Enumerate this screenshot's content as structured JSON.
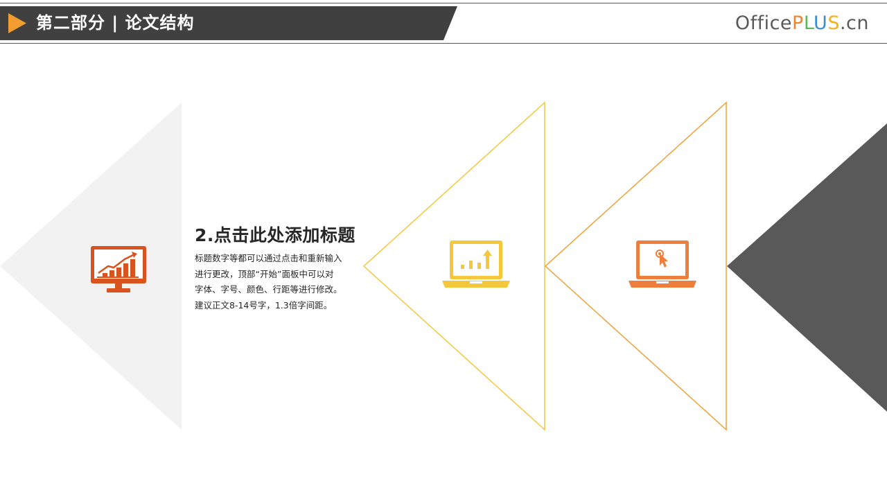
{
  "header": {
    "section_title": "第二部分 | 论文结构",
    "brand": {
      "part1": "Office",
      "p": "P",
      "l": "L",
      "u": "U",
      "s": "S",
      "suffix": ".cn"
    }
  },
  "content": {
    "heading": "2.点击此处添加标题",
    "body_lines": [
      "标题数字等都可以通过点击和重新输入",
      "进行更改，顶部“开始”面板中可以对",
      "字体、字号、颜色、行距等进行修改。",
      "建议正文8-14号字，1.3倍字间距。"
    ]
  },
  "icons": [
    "monitor-chart-icon",
    "laptop-chart-icon",
    "laptop-cursor-icon"
  ],
  "colors": {
    "header_bg": "#404040",
    "accent_orange": "#f39c2f",
    "icon_red": "#d9531e",
    "icon_yellow": "#f3c83c",
    "icon_orange": "#ee7e3b",
    "light_triangle": "#f2f2f2",
    "dark_triangle": "#595959"
  }
}
